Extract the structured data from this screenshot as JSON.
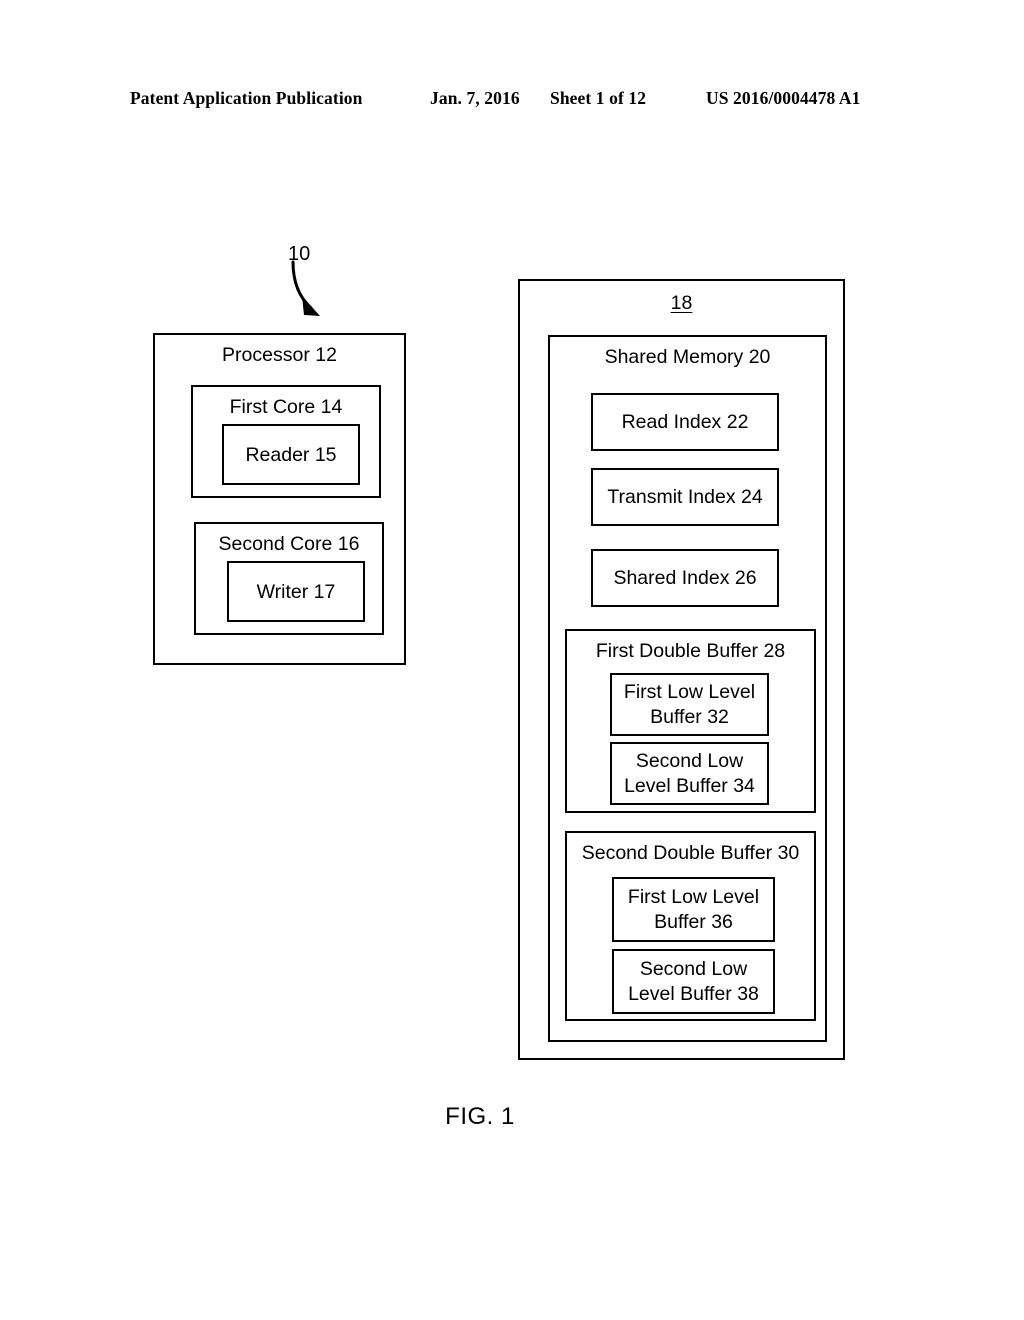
{
  "header": {
    "publication": "Patent Application Publication",
    "date": "Jan. 7, 2016",
    "sheet": "Sheet 1 of 12",
    "patent_number": "US 2016/0004478 A1"
  },
  "figure": {
    "caption": "FIG. 1",
    "system_reference": "10",
    "processor": {
      "label": "Processor 12",
      "cores": [
        {
          "label": "First Core 14",
          "component": "Reader 15"
        },
        {
          "label": "Second Core 16",
          "component": "Writer 17"
        }
      ]
    },
    "memory_system": {
      "label": "18",
      "shared_memory": {
        "label": "Shared Memory 20",
        "indices": [
          "Read Index 22",
          "Transmit Index 24",
          "Shared Index 26"
        ],
        "double_buffers": [
          {
            "label": "First Double Buffer 28",
            "buffers": [
              {
                "line1": "First Low Level",
                "line2": "Buffer 32"
              },
              {
                "line1": "Second Low",
                "line2": "Level Buffer 34"
              }
            ]
          },
          {
            "label": "Second Double Buffer 30",
            "buffers": [
              {
                "line1": "First Low Level",
                "line2": "Buffer 36"
              },
              {
                "line1": "Second Low",
                "line2": "Level Buffer 38"
              }
            ]
          }
        ]
      }
    }
  }
}
